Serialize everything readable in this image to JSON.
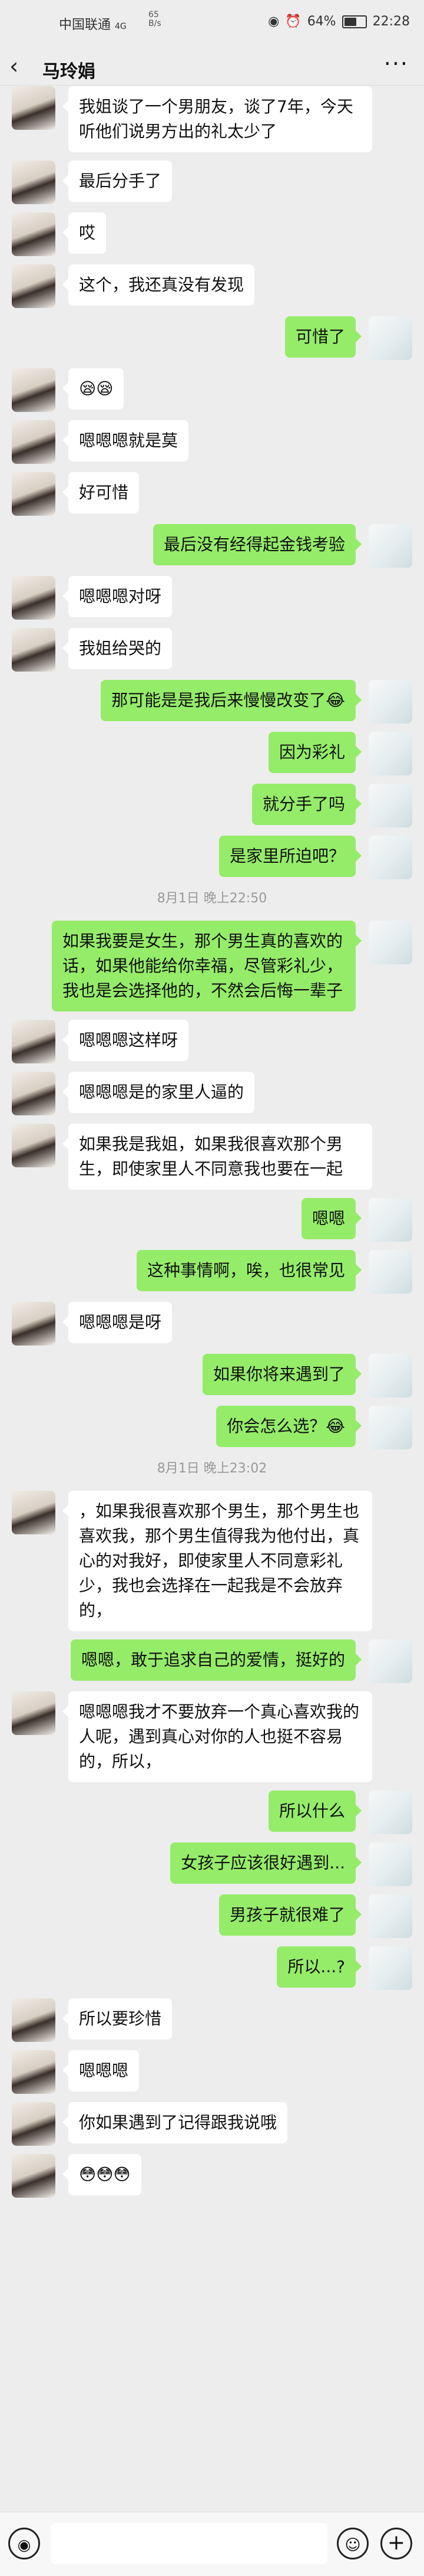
{
  "status_bar": {
    "carrier": "中国联通",
    "signal": "4G",
    "net_speed": "65",
    "net_unit": "B/s",
    "battery": "64%",
    "battery_level": 0.64,
    "time": "22:28"
  },
  "header": {
    "back": "‹",
    "title": "马玲娟",
    "more": "···"
  },
  "messages": [
    {
      "type": "msg",
      "from": "her",
      "text": "我姐谈了一个男朋友，谈了7年，今天听他们说男方出的礼太少了"
    },
    {
      "type": "msg",
      "from": "her",
      "text": "最后分手了"
    },
    {
      "type": "msg",
      "from": "her",
      "text": "哎"
    },
    {
      "type": "msg",
      "from": "her",
      "text": "这个，我还真没有发现"
    },
    {
      "type": "msg",
      "from": "me",
      "text": "可惜了"
    },
    {
      "type": "msg",
      "from": "her",
      "text": "😪😪"
    },
    {
      "type": "msg",
      "from": "her",
      "text": "嗯嗯嗯就是莫"
    },
    {
      "type": "msg",
      "from": "her",
      "text": "好可惜"
    },
    {
      "type": "msg",
      "from": "me",
      "text": "最后没有经得起金钱考验"
    },
    {
      "type": "msg",
      "from": "her",
      "text": "嗯嗯嗯对呀"
    },
    {
      "type": "msg",
      "from": "her",
      "text": "我姐给哭的"
    },
    {
      "type": "msg",
      "from": "me",
      "text": "那可能是是我后来慢慢改变了😂"
    },
    {
      "type": "msg",
      "from": "me",
      "text": "因为彩礼"
    },
    {
      "type": "msg",
      "from": "me",
      "text": "就分手了吗"
    },
    {
      "type": "msg",
      "from": "me",
      "text": "是家里所迫吧？"
    },
    {
      "type": "time",
      "text": "8月1日 晚上22:50"
    },
    {
      "type": "msg",
      "from": "me",
      "text": "如果我要是女生，那个男生真的喜欢的话，如果他能给你幸福，尽管彩礼少，我也是会选择他的，不然会后悔一辈子"
    },
    {
      "type": "msg",
      "from": "her",
      "text": "嗯嗯嗯这样呀"
    },
    {
      "type": "msg",
      "from": "her",
      "text": "嗯嗯嗯是的家里人逼的"
    },
    {
      "type": "msg",
      "from": "her",
      "text": "如果我是我姐，如果我很喜欢那个男生，即使家里人不同意我也要在一起"
    },
    {
      "type": "msg",
      "from": "me",
      "text": "嗯嗯"
    },
    {
      "type": "msg",
      "from": "me",
      "text": "这种事情啊，唉，也很常见"
    },
    {
      "type": "msg",
      "from": "her",
      "text": "嗯嗯嗯是呀"
    },
    {
      "type": "msg",
      "from": "me",
      "text": "如果你将来遇到了"
    },
    {
      "type": "msg",
      "from": "me",
      "text": "你会怎么选？😂"
    },
    {
      "type": "time",
      "text": "8月1日 晚上23:02"
    },
    {
      "type": "msg",
      "from": "her",
      "text": "，如果我很喜欢那个男生，那个男生也喜欢我，那个男生值得我为他付出，真心的对我好，即使家里人不同意彩礼少，我也会选择在一起我是不会放弃的，"
    },
    {
      "type": "msg",
      "from": "me",
      "text": "嗯嗯，敢于追求自己的爱情，挺好的"
    },
    {
      "type": "msg",
      "from": "her",
      "text": "嗯嗯嗯我才不要放弃一个真心喜欢我的人呢，遇到真心对你的人也挺不容易的，所以，"
    },
    {
      "type": "msg",
      "from": "me",
      "text": "所以什么"
    },
    {
      "type": "msg",
      "from": "me",
      "text": "女孩子应该很好遇到..."
    },
    {
      "type": "msg",
      "from": "me",
      "text": "男孩子就很难了"
    },
    {
      "type": "msg",
      "from": "me",
      "text": "所以...?"
    },
    {
      "type": "msg",
      "from": "her",
      "text": "所以要珍惜"
    },
    {
      "type": "msg",
      "from": "her",
      "text": "嗯嗯嗯"
    },
    {
      "type": "msg",
      "from": "her",
      "text": "你如果遇到了记得跟我说哦"
    },
    {
      "type": "msg",
      "from": "her",
      "text": "😳😳😳"
    }
  ],
  "input_bar": {
    "voice_icon": "voice-icon",
    "emoji_icon": "emoji-icon",
    "plus_icon": "plus-icon",
    "voice_glyph": "◉",
    "emoji_glyph": "☺",
    "plus_glyph": "+"
  }
}
